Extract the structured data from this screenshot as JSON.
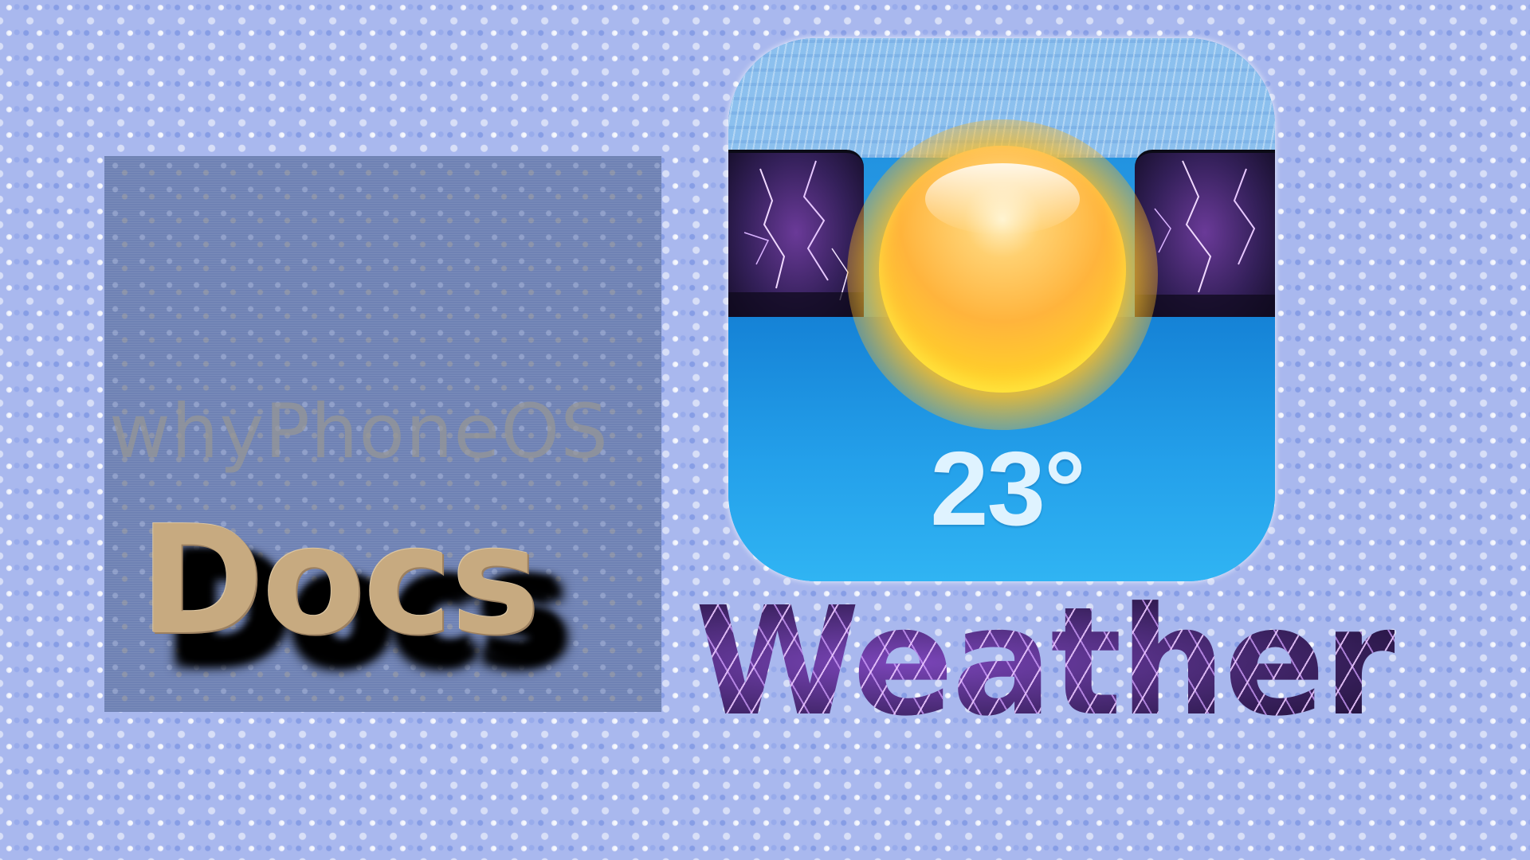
{
  "docs": {
    "subtitle": "whyPhoneOS",
    "title": "Docs"
  },
  "weather": {
    "temperature": "23°",
    "label": "Weather"
  },
  "colors": {
    "background": "#a9b8ee",
    "docs_panel": "#6f82b4",
    "docs_title": "#c7aa80",
    "weather_blue": "#24a0ea",
    "sun": "#ffb43c",
    "storm_purple": "#3a215f",
    "temperature_text": "#dff3ff"
  },
  "icons": {
    "weather_icon": "sun-over-storm-icon",
    "sun": "sun-icon",
    "storm": "lightning-storm-icon"
  }
}
